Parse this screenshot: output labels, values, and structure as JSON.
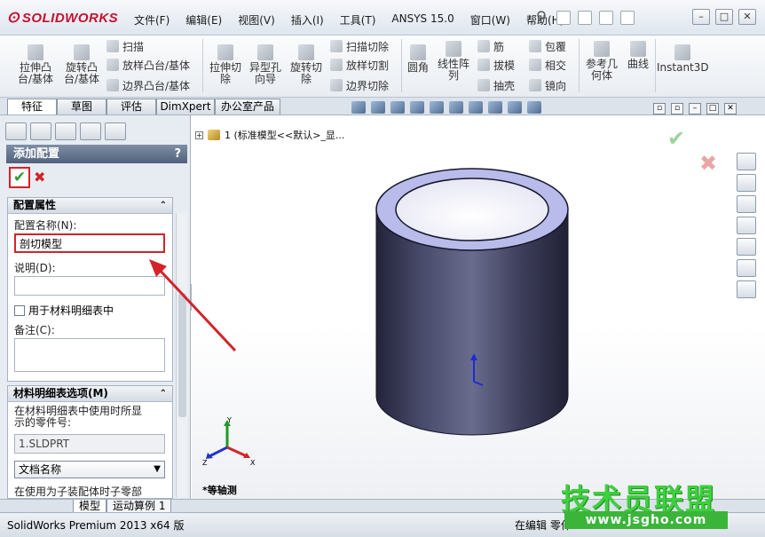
{
  "app": {
    "logo": "SOLIDWORKS"
  },
  "menu": [
    "文件(F)",
    "编辑(E)",
    "视图(V)",
    "插入(I)",
    "工具(T)",
    "ANSYS 15.0",
    "窗口(W)",
    "帮助(H)"
  ],
  "ribbon": {
    "big": [
      {
        "label": "拉伸凸\n台/基体"
      },
      {
        "label": "旋转凸\n台/基体"
      },
      {
        "label": "拉伸切\n除"
      },
      {
        "label": "异型孔\n向导"
      },
      {
        "label": "旋转切\n除"
      },
      {
        "label": "圆角"
      },
      {
        "label": "线性阵\n列"
      },
      {
        "label": "参考几\n何体"
      },
      {
        "label": "曲线"
      },
      {
        "label": "Instant3D"
      }
    ],
    "small": [
      "扫描",
      "放样凸台/基体",
      "边界凸台/基体",
      "扫描切除",
      "放样切割",
      "边界切除",
      "筋",
      "拔模",
      "抽壳",
      "包覆",
      "相交",
      "镜向"
    ]
  },
  "tabs": [
    "特征",
    "草图",
    "评估",
    "DimXpert",
    "办公室产品"
  ],
  "panel": {
    "title": "添加配置",
    "help": "?",
    "group1": {
      "title": "配置属性",
      "name_label": "配置名称(N):",
      "name_value": "剖切模型",
      "desc_label": "说明(D):",
      "desc_value": "",
      "bom_check": "用于材料明细表中",
      "notes_label": "备注(C):",
      "notes_value": ""
    },
    "group2": {
      "title": "材料明细表选项(M)",
      "hint": "在材料明细表中使用时所显\n示的零件号:",
      "part_no": "1.SLDPRT",
      "doc_select": "文档名称",
      "footer": "在使用为子装配体时子零部"
    }
  },
  "graphics": {
    "tree_item": "1  (标准模型<<默认>_显...",
    "view_name": "*等轴测",
    "triad": {
      "x": "X",
      "y": "Y",
      "z": "Z"
    }
  },
  "bottom_tabs": [
    "模型",
    "运动算例 1"
  ],
  "status": {
    "left": "SolidWorks Premium 2013 x64 版",
    "right": "在编辑 零件"
  },
  "watermark": {
    "title": "技术员联盟",
    "url": "www.jsgho.com"
  },
  "colors": {
    "highlight": "#d3232a",
    "ok_green": "#2f9b2f",
    "header": "#50627c",
    "cylinder": "#3b3c57",
    "cylinder_top": "#b9bbea"
  }
}
